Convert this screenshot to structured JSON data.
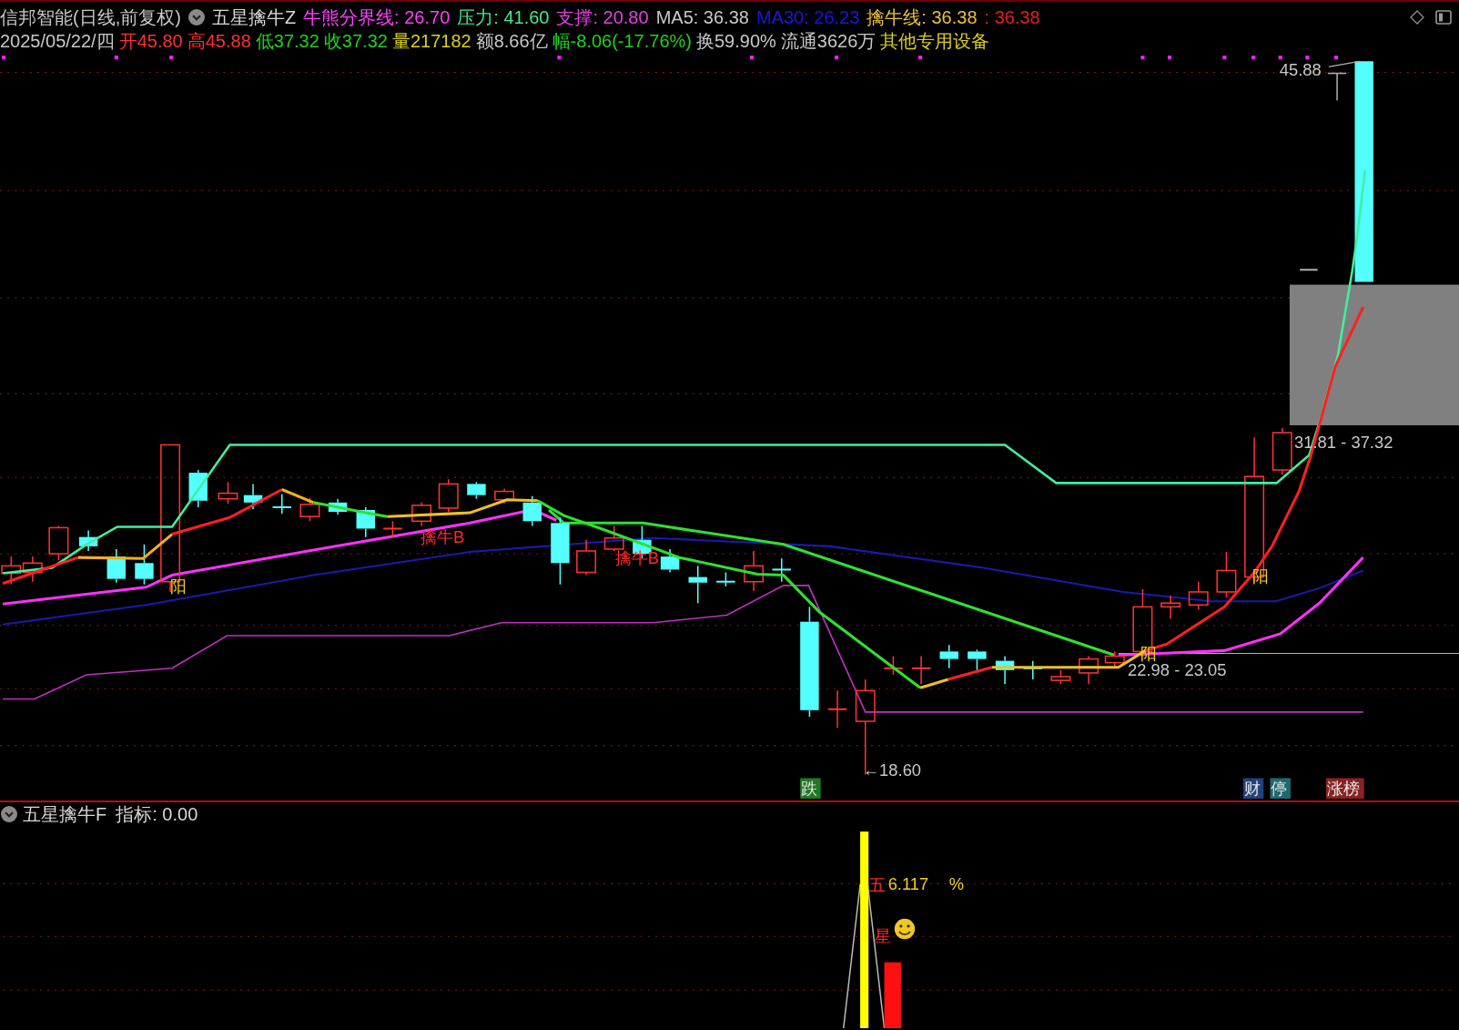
{
  "header": {
    "title": "信邦智能(日线,前复权)",
    "indicator": "五星擒牛Z",
    "values": [
      {
        "text": "牛熊分界线: 26.70",
        "color": "#ff40ff"
      },
      {
        "text": "压力: 41.60",
        "color": "#40e890"
      },
      {
        "text": "支撑: 20.80",
        "color": "#e040e0"
      },
      {
        "text": "MA5: 36.38",
        "color": "#c8c8c8"
      },
      {
        "text": "MA30: 26.23",
        "color": "#1818e0"
      },
      {
        "text": "擒牛线: 36.38",
        "color": "#e8c040"
      },
      {
        "text": ": 36.38",
        "color": "#e02020"
      }
    ]
  },
  "quote": [
    {
      "text": "2025/05/22/四",
      "color": "#c8c8c8"
    },
    {
      "text": "开45.80",
      "color": "#ff3030"
    },
    {
      "text": "高45.88",
      "color": "#ff3030"
    },
    {
      "text": "低37.32",
      "color": "#20d020"
    },
    {
      "text": "收37.32",
      "color": "#20d020"
    },
    {
      "text": "量217182",
      "color": "#d8d020"
    },
    {
      "text": "额8.66亿",
      "color": "#c8c8c8"
    },
    {
      "text": "幅-8.06(-17.76%)",
      "color": "#20d020"
    },
    {
      "text": "换59.90%",
      "color": "#c8c8c8"
    },
    {
      "text": "流通3626万",
      "color": "#c8c8c8"
    },
    {
      "text": "其他专用设备",
      "color": "#d8d020"
    }
  ],
  "chart": {
    "labels": [
      {
        "kind": "price",
        "text": "45.88"
      },
      {
        "kind": "price",
        "text": "31.81 - 37.32"
      },
      {
        "kind": "buy",
        "text": "擒牛B"
      },
      {
        "kind": "buy",
        "text": "擒牛B"
      },
      {
        "kind": "signal",
        "text": "阳"
      },
      {
        "kind": "signal",
        "text": "阳"
      },
      {
        "kind": "signal",
        "text": "阳"
      },
      {
        "kind": "price",
        "text": "22.98 - 23.05"
      },
      {
        "kind": "price",
        "text": "←18.60"
      }
    ],
    "tags": [
      {
        "text": "跌",
        "color": "#1f7a24"
      },
      {
        "text": "财",
        "color": "#24427a"
      },
      {
        "text": "停",
        "color": "#1f6a70"
      },
      {
        "text": "涨榜",
        "color": "#8a2222"
      }
    ]
  },
  "indicator_panel": {
    "name": "五星擒牛F",
    "reading": "指标: 0.00",
    "labels": [
      {
        "kind": "char",
        "text": "五"
      },
      {
        "kind": "value",
        "text": "6.117"
      },
      {
        "kind": "value",
        "text": "%"
      },
      {
        "kind": "char",
        "text": "星"
      }
    ]
  }
}
